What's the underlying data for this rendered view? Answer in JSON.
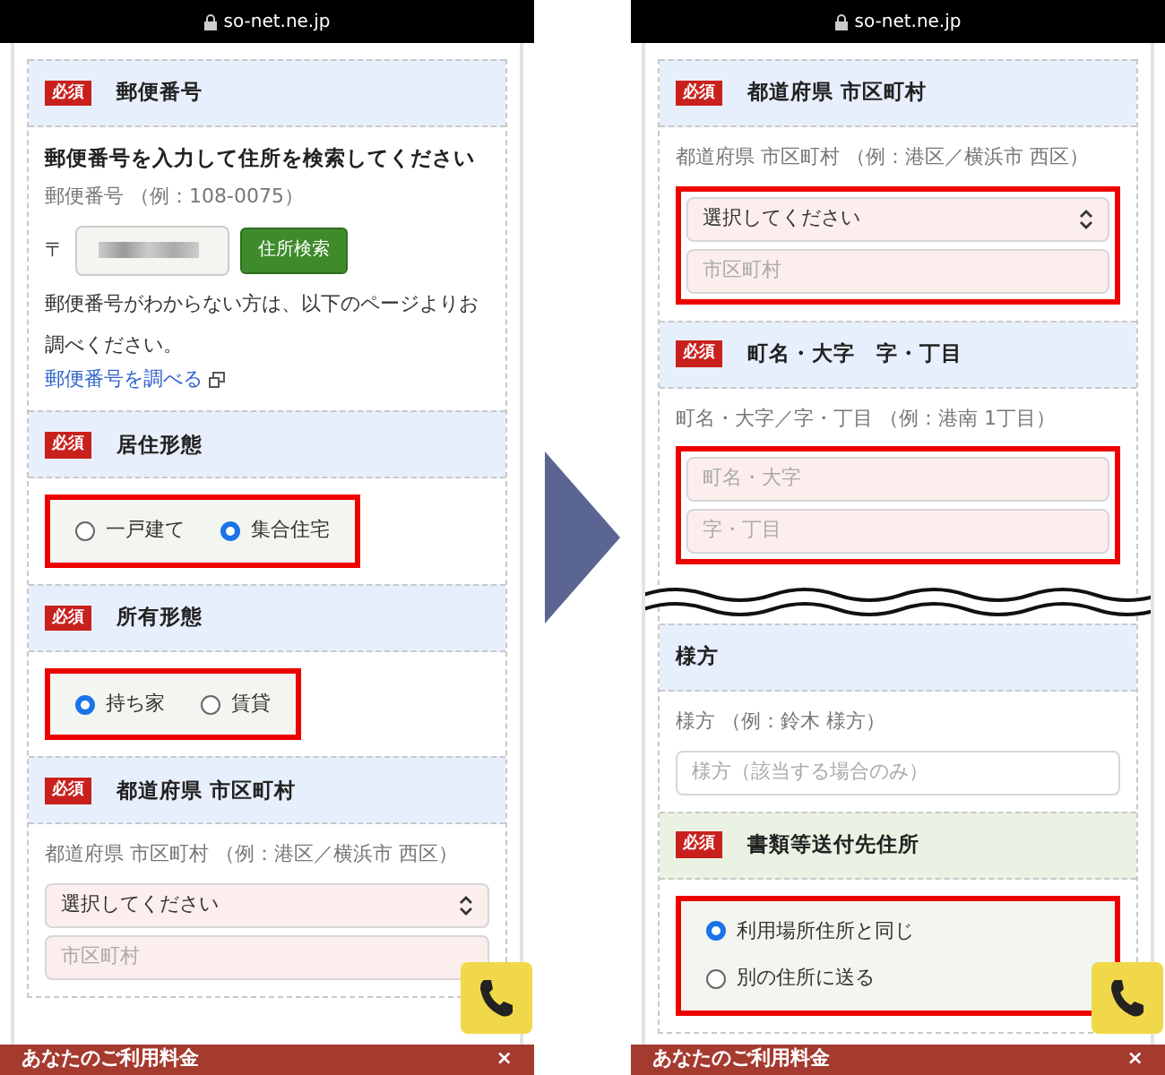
{
  "panels": [
    {
      "url": "so-net.ne.jp",
      "blocks": [
        {
          "kind": "header",
          "badge": "必須",
          "title": "郵便番号",
          "color": "#e8effc"
        },
        {
          "kind": "body",
          "items": [
            {
              "kind": "lead",
              "text": "郵便番号を入力して住所を検索してください"
            },
            {
              "kind": "hint",
              "text": "郵便番号 （例：108-0075）"
            },
            {
              "kind": "postal",
              "symbol": "〒",
              "button": "住所検索"
            },
            {
              "kind": "note",
              "text": "郵便番号がわからない方は、以下のページよりお調べください。"
            },
            {
              "kind": "link",
              "text": "郵便番号を調べる"
            }
          ]
        },
        {
          "kind": "header",
          "badge": "必須",
          "title": "居住形態",
          "color": "#e8effc"
        },
        {
          "kind": "body",
          "items": [
            {
              "kind": "radios",
              "highlighted": true,
              "vertical": false,
              "options": [
                {
                  "label": "一戸建て",
                  "selected": false
                },
                {
                  "label": "集合住宅",
                  "selected": true
                }
              ]
            }
          ]
        },
        {
          "kind": "header",
          "badge": "必須",
          "title": "所有形態",
          "color": "#e8effc"
        },
        {
          "kind": "body",
          "items": [
            {
              "kind": "radios",
              "highlighted": true,
              "vertical": false,
              "options": [
                {
                  "label": "持ち家",
                  "selected": true
                },
                {
                  "label": "賃貸",
                  "selected": false
                }
              ]
            }
          ]
        },
        {
          "kind": "header",
          "badge": "必須",
          "title": "都道府県 市区町村",
          "color": "#e8effc"
        },
        {
          "kind": "body",
          "items": [
            {
              "kind": "hint",
              "text": "都道府県 市区町村 （例：港区／横浜市 西区）"
            },
            {
              "kind": "fields",
              "highlighted": false,
              "fields": [
                {
                  "kind": "select",
                  "value": "選択してください",
                  "required": true
                },
                {
                  "kind": "input",
                  "placeholder": "市区町村",
                  "required": true
                }
              ]
            }
          ]
        }
      ],
      "footer": {
        "title": "あなたのご利用料金",
        "close": "×"
      }
    },
    {
      "url": "so-net.ne.jp",
      "blocks": [
        {
          "kind": "header",
          "badge": "必須",
          "title": "都道府県 市区町村",
          "color": "#e8effc"
        },
        {
          "kind": "body",
          "items": [
            {
              "kind": "hint",
              "text": "都道府県 市区町村 （例：港区／横浜市 西区）"
            },
            {
              "kind": "fields",
              "highlighted": true,
              "fields": [
                {
                  "kind": "select",
                  "value": "選択してください",
                  "required": true
                },
                {
                  "kind": "input",
                  "placeholder": "市区町村",
                  "required": true
                }
              ]
            }
          ]
        },
        {
          "kind": "header",
          "badge": "必須",
          "title": "町名・大字　字・丁目",
          "color": "#e8effc"
        },
        {
          "kind": "body",
          "items": [
            {
              "kind": "hint",
              "text": "町名・大字／字・丁目 （例：港南 1丁目）"
            },
            {
              "kind": "fields",
              "highlighted": true,
              "fields": [
                {
                  "kind": "input",
                  "placeholder": "町名・大字",
                  "required": true
                },
                {
                  "kind": "input",
                  "placeholder": "字・丁目",
                  "required": true
                }
              ]
            }
          ]
        },
        {
          "kind": "break"
        },
        {
          "kind": "header",
          "title": "様方",
          "color": "#e8effc"
        },
        {
          "kind": "body",
          "items": [
            {
              "kind": "hint",
              "text": "様方 （例：鈴木 様方）"
            },
            {
              "kind": "fields",
              "highlighted": false,
              "fields": [
                {
                  "kind": "input",
                  "placeholder": "様方（該当する場合のみ）",
                  "required": false
                }
              ]
            }
          ]
        },
        {
          "kind": "header",
          "badge": "必須",
          "title": "書類等送付先住所",
          "color": "#eaf3e3"
        },
        {
          "kind": "body",
          "items": [
            {
              "kind": "radios",
              "highlighted": true,
              "vertical": true,
              "options": [
                {
                  "label": "利用場所住所と同じ",
                  "selected": true
                },
                {
                  "label": "別の住所に送る",
                  "selected": false
                }
              ]
            }
          ]
        }
      ],
      "footer": {
        "title": "あなたのご利用料金",
        "close": "×"
      }
    }
  ]
}
